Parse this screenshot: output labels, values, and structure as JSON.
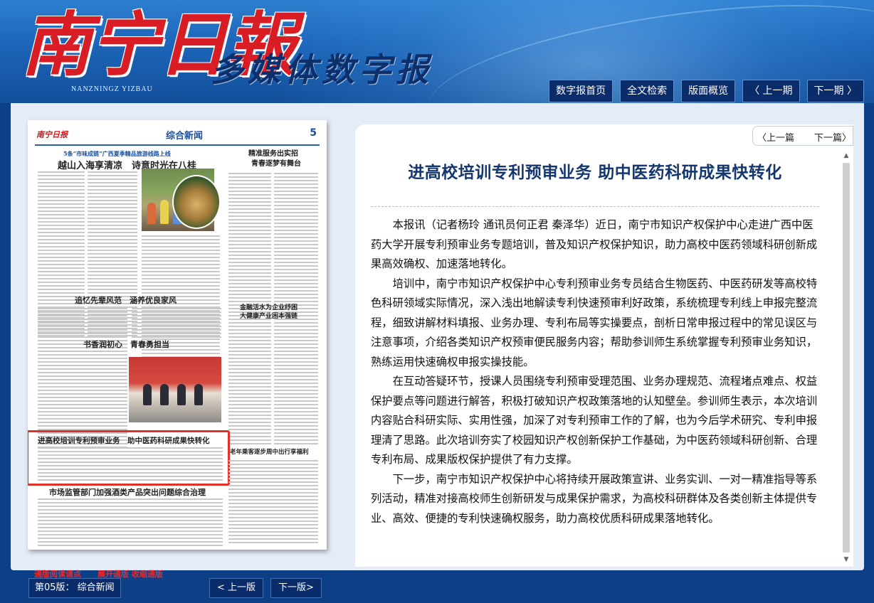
{
  "header": {
    "logo_main": "南宁日報",
    "logo_pinyin": "NANZNINGZ YIZBAU",
    "logo_sub": "多媒体数字报"
  },
  "topnav": {
    "home": "数字报首页",
    "search": "全文检索",
    "overview": "版面概览",
    "prev_issue": "〈 上一期",
    "next_issue": "下一期 〉"
  },
  "paper": {
    "masthead": "南宁日报",
    "section": "综合新闻",
    "page_no": "5",
    "h_top_small": "5条“市味成链”广西夏季精品旅游线路上线",
    "h_top": "越山入海享清凉　诗意时光在八桂",
    "h_right1": "精准服务出实招",
    "h_right2": "青春逐梦有舞台",
    "h_mid_left": "追忆先辈风范　涵养优良家风",
    "h_mid_left2": "书香润初心　青春勇担当",
    "h_mid_right1": "金融活水为企业纾困",
    "h_mid_right2": "大健康产业困本强链",
    "h_highlight": "进高校培训专利预审业务　助中医药科研成果快转化",
    "h_right3": "老年乘客逐步周中出行享福利",
    "h_bottom": "市场监管部门加强酒类产品突出问题综合治理"
  },
  "article": {
    "nav_prev": "〈上一篇",
    "nav_next": "下一篇〉",
    "title": "进高校培训专利预审业务 助中医药科研成果快转化",
    "paragraphs": [
      "本报讯（记者杨玲 通讯员何正君 秦泽华）近日，南宁市知识产权保护中心走进广西中医药大学开展专利预审业务专题培训，普及知识产权保护知识，助力高校中医药领域科研创新成果高效确权、加速落地转化。",
      "培训中，南宁市知识产权保护中心专利预审业务专员结合生物医药、中医药研发等高校特色科研领域实际情况，深入浅出地解读专利快速预审利好政策，系统梳理专利线上申报完整流程，细致讲解材料填报、业务办理、专利布局等实操要点，剖析日常申报过程中的常见误区与注意事项，介绍各类知识产权预审便民服务内容；帮助参训师生系统掌握专利预审业务知识，熟练运用快速确权申报实操技能。",
      "在互动答疑环节，授课人员围绕专利预审受理范围、业务办理规范、流程堵点难点、权益保护要点等问题进行解答，积极打破知识产权政策落地的认知壁垒。参训师生表示，本次培训内容贴合科研实际、实用性强，加深了对专利预审工作的了解，也为今后学术研究、专利申报理清了思路。此次培训夯实了校园知识产权创新保护工作基础，为中医药领域科研创新、合理专利布局、成果版权保护提供了有力支撑。",
      "下一步，南宁市知识产权保护中心将持续开展政策宣讲、业务实训、一对一精准指导等系列活动，精准对接高校师生创新研发与成果保护需求，为高校科研群体及各类创新主体提供专业、高效、便捷的专利快速确权服务，助力高校优质科研成果落地转化。"
    ]
  },
  "bottom": {
    "tips": "通版阅读请点",
    "expand": "展开通版",
    "collapse": "收缩通版",
    "current_page": "第05版：  综合新闻",
    "prev_page": "< 上一版",
    "next_page": "下一版>"
  },
  "colors": {
    "header_blue": "#1c64b8",
    "nav_button": "#0b2c6a",
    "title_blue": "#13376e",
    "highlight_red": "#e0322b"
  }
}
